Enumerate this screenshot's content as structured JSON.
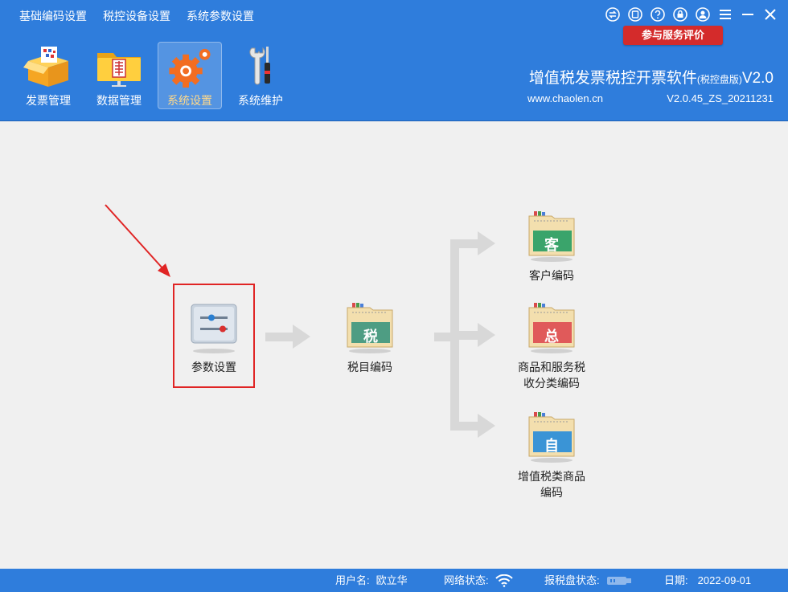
{
  "menu": [
    "基础编码设置",
    "税控设备设置",
    "系统参数设置"
  ],
  "eval_button": "参与服务评价",
  "toolbar": [
    {
      "label": "发票管理",
      "icon": "invoice-box-icon"
    },
    {
      "label": "数据管理",
      "icon": "data-folder-icon"
    },
    {
      "label": "系统设置",
      "icon": "gear-settings-icon",
      "active": true
    },
    {
      "label": "系统维护",
      "icon": "maintenance-tools-icon"
    }
  ],
  "brand": {
    "title": "增值税发票税控开票软件",
    "edition": "(税控盘版)",
    "version_suffix": "V2.0",
    "url": "www.chaolen.cn",
    "build": "V2.0.45_ZS_20211231"
  },
  "nodes": {
    "params": "参数设置",
    "tax_item": "税目编码",
    "tax_item_char": "税",
    "customer": "客户编码",
    "customer_char": "客",
    "goods": "商品和服务税\n收分类编码",
    "goods_char": "总",
    "vat_goods": "增值税类商品\n编码",
    "vat_goods_char": "自"
  },
  "status": {
    "user_label": "用户名:",
    "user_value": "欧立华",
    "network_label": "网络状态:",
    "disk_label": "报税盘状态:",
    "date_label": "日期:",
    "date_value": "2022-09-01"
  },
  "colors": {
    "header_bg": "#2f7ddc",
    "tab_green": "#3aa46b",
    "tab_red": "#e05a5a",
    "tab_blue": "#3a94d6",
    "tab_teal": "#4e9d83"
  }
}
